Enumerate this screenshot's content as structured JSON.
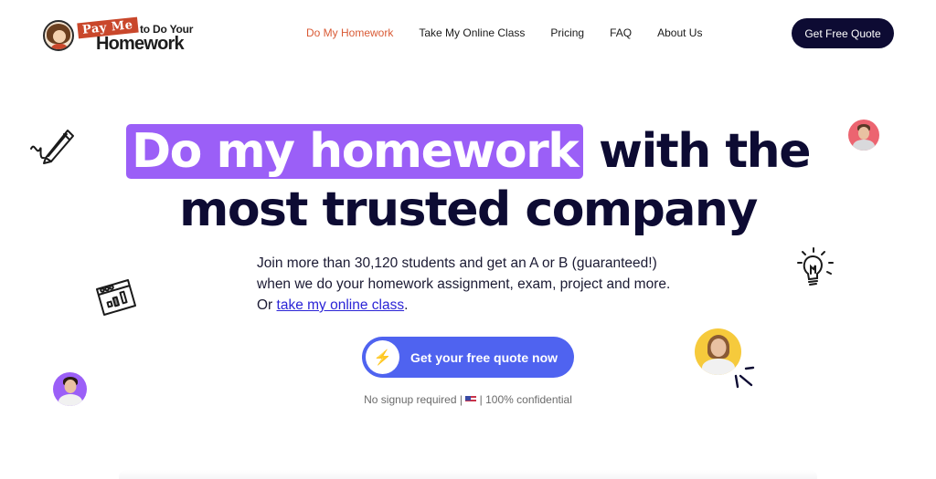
{
  "header": {
    "logo": {
      "pay_me": "Pay Me",
      "to_do_your": "to Do Your",
      "homework": "Homework"
    },
    "nav": [
      {
        "label": "Do My Homework",
        "active": true
      },
      {
        "label": "Take My Online Class",
        "active": false
      },
      {
        "label": "Pricing",
        "active": false
      },
      {
        "label": "FAQ",
        "active": false
      },
      {
        "label": "About Us",
        "active": false
      }
    ],
    "cta_label": "Get Free Quote"
  },
  "hero": {
    "title_highlight": "Do my homework",
    "title_rest_line1": "with the",
    "title_line2": "most trusted company",
    "subtext_part1": "Join more than 30,120 students and get an A or B (guaranteed!) when we do your homework assignment, exam, project and more.",
    "subtext_or": "Or",
    "subtext_link": "take my online class",
    "subtext_end": ".",
    "cta_icon": "lightning-bolt-icon",
    "cta_label": "Get your free quote now",
    "note_left": "No signup required |",
    "note_flag": "us-flag-icon",
    "note_right": "| 100% confidential"
  },
  "decorations": {
    "icons": [
      "pencil-icon",
      "browser-chart-icon",
      "lightbulb-icon",
      "sparkle-lines-icon"
    ],
    "avatars": [
      {
        "name": "avatar-purple",
        "bg": "#9b5ff7"
      },
      {
        "name": "avatar-red",
        "bg": "#ec6470"
      },
      {
        "name": "avatar-yellow",
        "bg": "#f6ca3c"
      }
    ]
  },
  "colors": {
    "brand_dark": "#0d0b33",
    "highlight_purple": "#9b5ff7",
    "cta_blue": "#4f63f0",
    "nav_active": "#d95a35",
    "link_blue": "#2b24d6"
  }
}
